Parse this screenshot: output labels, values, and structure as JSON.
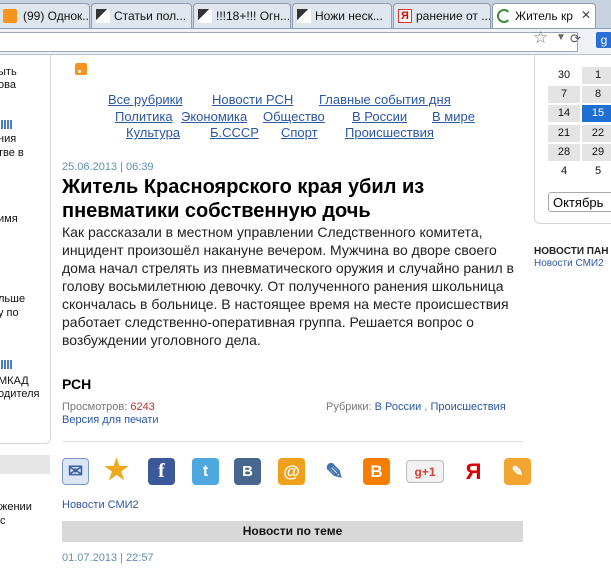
{
  "browser": {
    "tabs": [
      {
        "label": "(99) Однок...",
        "icon": "odnoklassniki-icon"
      },
      {
        "label": "Статьи пол...",
        "icon": "gun-icon"
      },
      {
        "label": "!!!18+!!! Огн...",
        "icon": "gun-icon"
      },
      {
        "label": "Ножи неск...",
        "icon": "gun-icon"
      },
      {
        "label": "ранение от ...",
        "icon": "yandex-icon"
      },
      {
        "label": "Житель кр",
        "icon": "loading-icon"
      }
    ]
  },
  "left_sidebar": {
    "fragments": [
      "ыть",
      "ова",
      "ния",
      "тве в",
      "имя",
      "льше",
      "у по",
      "МКАД",
      "одителя",
      "жении",
      "с"
    ]
  },
  "nav": {
    "row1": [
      "Все рубрики",
      "Новости РСН",
      "Главные события дня"
    ],
    "row2": [
      "Политика",
      "Экономика",
      "Общество",
      "В России",
      "В мире"
    ],
    "row3": [
      "Культура",
      "Б.СССР",
      "Спорт",
      "Происшествия"
    ]
  },
  "article": {
    "date": "25.06.2013 | 06:39",
    "title": "Житель Красноярского края убил из пневматики собственную дочь",
    "body": "Как рассказали в местном управлении Следственного комитета, инцидент произошёл накануне вечером. Мужчина во дворе своего дома начал стрелять из пневматического оружия и случайно ранил в голову восьмилетнюю девочку. От полученного ранения школьница скончалась в больнице. В настоящее время на месте происшествия работает следственно-оперативная группа. Решается вопрос о возбуждении уголовного дела.",
    "source": "РСН",
    "views_label": "Просмотров:",
    "views_count": "6243",
    "rubrics_label": "Рубрики:",
    "rubric1": "В России",
    "rubric2": "Происшествия",
    "print_link": "Версия для печати"
  },
  "share_icons": [
    "email-icon",
    "favorite-star-icon",
    "facebook-icon",
    "twitter-icon",
    "vkontakte-icon",
    "mailru-icon",
    "livejournal-icon",
    "blogger-icon",
    "google-plus-icon",
    "yandex-icon",
    "liveinternet-icon"
  ],
  "smi_link": "Новости СМИ2",
  "related_header": "Новости по теме",
  "related_date": "01.07.2013 | 22:57",
  "calendar": {
    "rows": [
      [
        "30",
        "1"
      ],
      [
        "7",
        "8"
      ],
      [
        "14",
        "15"
      ],
      [
        "21",
        "22"
      ],
      [
        "28",
        "29"
      ],
      [
        "4",
        "5"
      ]
    ],
    "selected": "15",
    "month": "Октябрь"
  },
  "right": {
    "heading": "НОВОСТИ ПАН",
    "link": "Новости СМИ2"
  },
  "colors": {
    "link": "#2b57a4",
    "date": "#5f8fb3",
    "calendar_selected": "#1f6fd2"
  }
}
